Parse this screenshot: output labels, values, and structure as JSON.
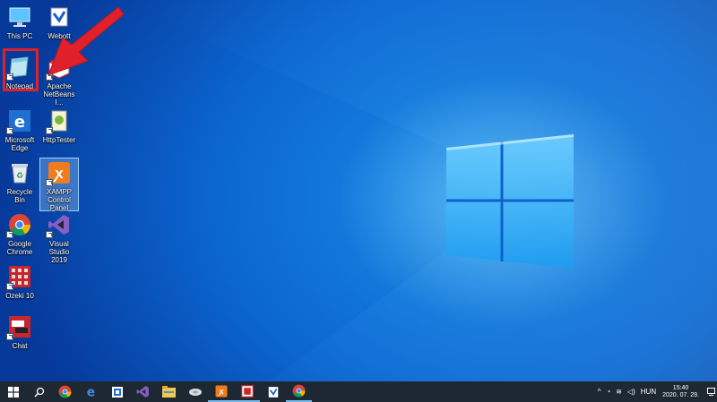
{
  "desktop": {
    "icons": [
      {
        "id": "this-pc",
        "label": "This PC"
      },
      {
        "id": "webot",
        "label": "Webott"
      },
      {
        "id": "notepad",
        "label": "Notepad"
      },
      {
        "id": "netbeans",
        "label": "Apache NetBeans I..."
      },
      {
        "id": "edge",
        "label": "Microsoft Edge"
      },
      {
        "id": "httptester",
        "label": "HttpTester"
      },
      {
        "id": "recycle-bin",
        "label": "Recycle Bin"
      },
      {
        "id": "xampp",
        "label": "XAMPP Control Panel"
      },
      {
        "id": "chrome",
        "label": "Google Chrome"
      },
      {
        "id": "visual-studio",
        "label": "Visual Studio 2019"
      },
      {
        "id": "ozeki",
        "label": "Ozeki 10"
      },
      {
        "id": "chat",
        "label": "Chat"
      }
    ],
    "annotation_color": "#e0202a"
  },
  "taskbar": {
    "pinned": [
      "windows-logo-icon",
      "search-icon",
      "chrome-icon",
      "edge-icon",
      "store-icon",
      "visual-studio-icon",
      "file-explorer-icon",
      "disk-icon",
      "xampp-icon",
      "ozeki-icon",
      "webot-icon",
      "chrome-icon"
    ],
    "tray": {
      "language": "HUN",
      "time": "15:40",
      "date": "2020. 07. 29."
    }
  }
}
